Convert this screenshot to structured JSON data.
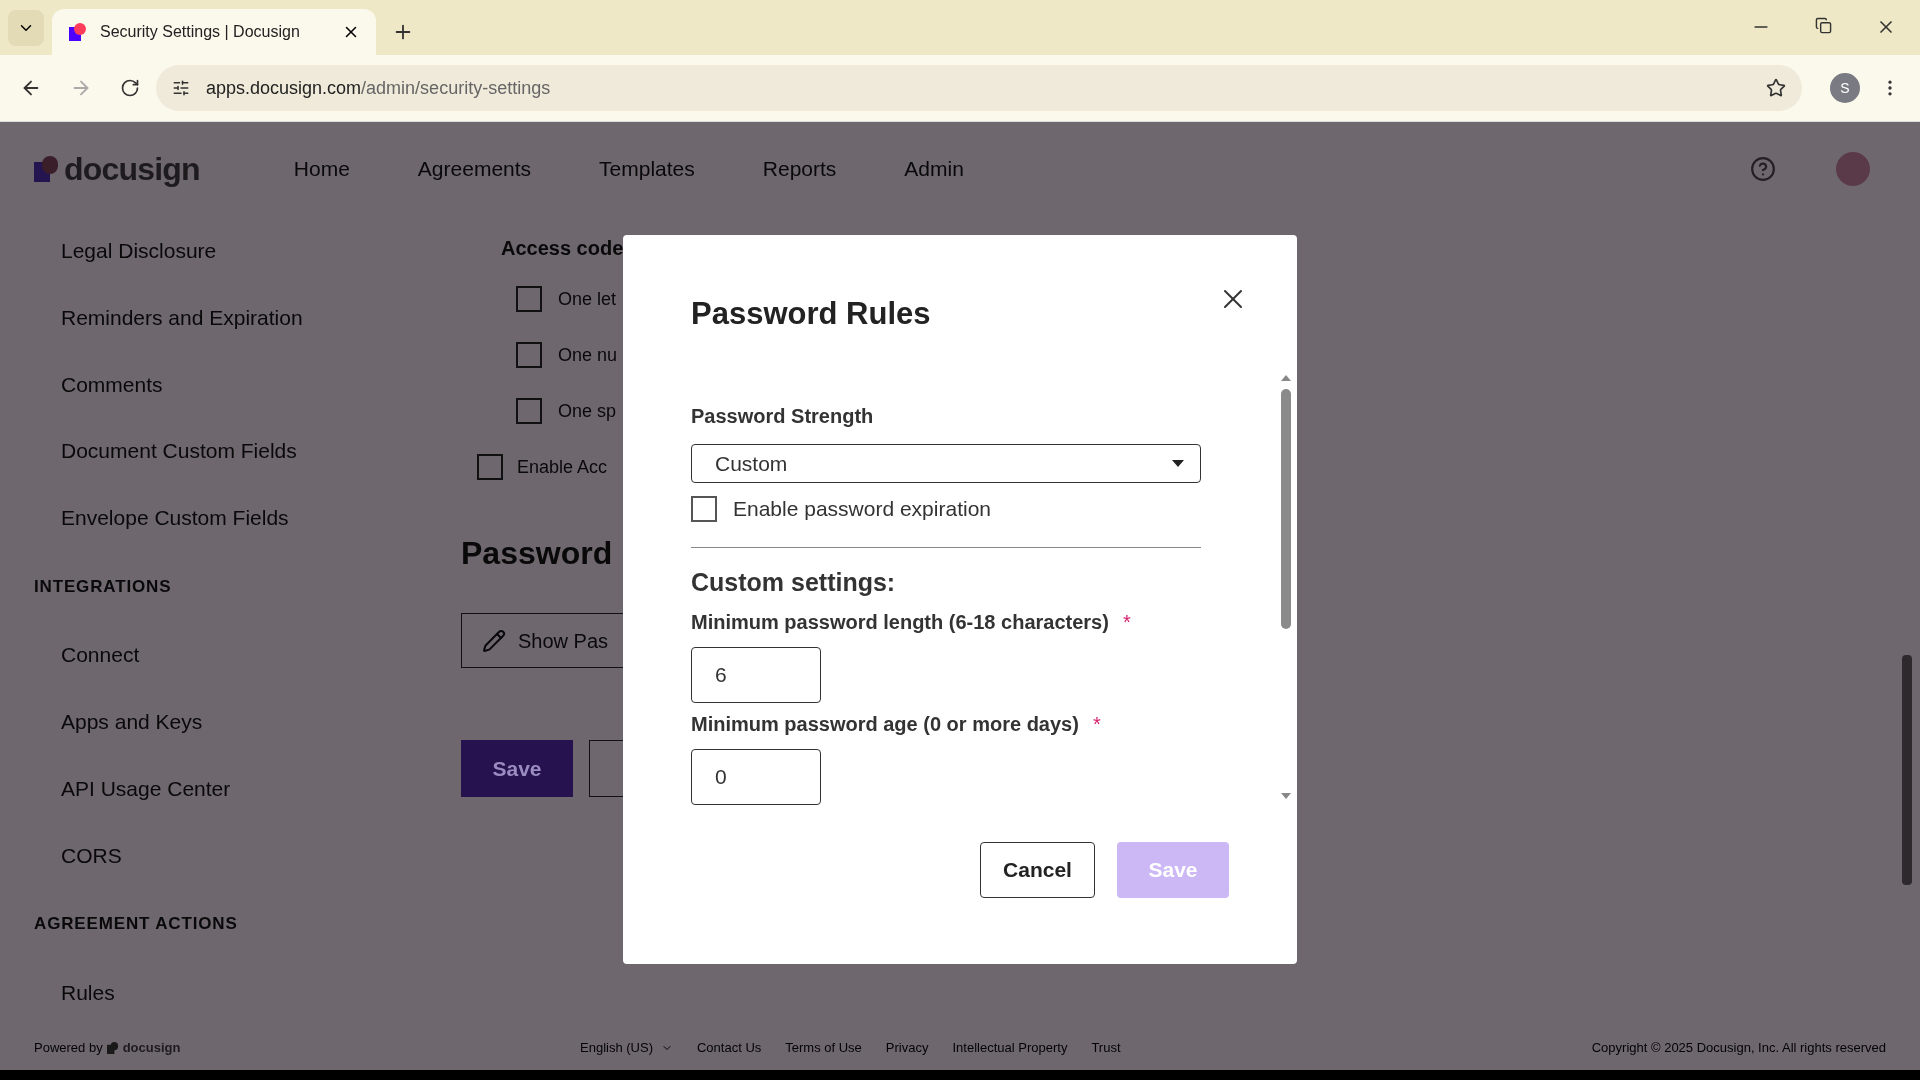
{
  "browser": {
    "tabs": [
      {
        "title": "Security Settings | Docusign",
        "selected": true
      }
    ],
    "url_host": "apps.docusign.com",
    "url_path": "/admin/security-settings",
    "profile_initial": "S"
  },
  "header": {
    "logo": "docusign",
    "nav": [
      "Home",
      "Agreements",
      "Templates",
      "Reports",
      "Admin"
    ]
  },
  "sidebar": {
    "items": [
      {
        "kind": "item",
        "label": "Legal Disclosure"
      },
      {
        "kind": "item",
        "label": "Reminders and Expiration"
      },
      {
        "kind": "item",
        "label": "Comments"
      },
      {
        "kind": "item",
        "label": "Document Custom Fields"
      },
      {
        "kind": "item",
        "label": "Envelope Custom Fields"
      },
      {
        "kind": "section",
        "label": "INTEGRATIONS"
      },
      {
        "kind": "item",
        "label": "Connect"
      },
      {
        "kind": "item",
        "label": "Apps and Keys"
      },
      {
        "kind": "item",
        "label": "API Usage Center"
      },
      {
        "kind": "item",
        "label": "CORS"
      },
      {
        "kind": "section",
        "label": "AGREEMENT ACTIONS"
      },
      {
        "kind": "item",
        "label": "Rules"
      }
    ]
  },
  "main": {
    "access_code_label": "Access code",
    "options": [
      {
        "label": "One let",
        "checked": false
      },
      {
        "label": "One nu",
        "checked": false
      },
      {
        "label": "One sp",
        "checked": false
      }
    ],
    "enable_option": {
      "label": "Enable Acc",
      "checked": false
    },
    "password_heading": "Password",
    "show_button": "Show Pas",
    "save_button": "Save"
  },
  "dialog": {
    "title": "Password Rules",
    "strength_label": "Password Strength",
    "strength_value": "Custom",
    "expiration": {
      "label": "Enable password expiration",
      "checked": false
    },
    "section_title": "Custom settings:",
    "fields": [
      {
        "label": "Minimum password length (6-18 characters)",
        "required_mark": "*",
        "value": "6"
      },
      {
        "label": "Minimum password age (0 or more days)",
        "required_mark": "*",
        "value": "0"
      }
    ],
    "cancel_button": "Cancel",
    "save_button": {
      "label": "Save",
      "disabled": true
    }
  },
  "footer": {
    "powered_by": "Powered by",
    "logo": "docusign",
    "language": "English (US)",
    "links": [
      "Contact Us",
      "Terms of Use",
      "Privacy",
      "Intellectual Property",
      "Trust"
    ],
    "copyright": "Copyright © 2025 Docusign, Inc. All rights reserved"
  }
}
